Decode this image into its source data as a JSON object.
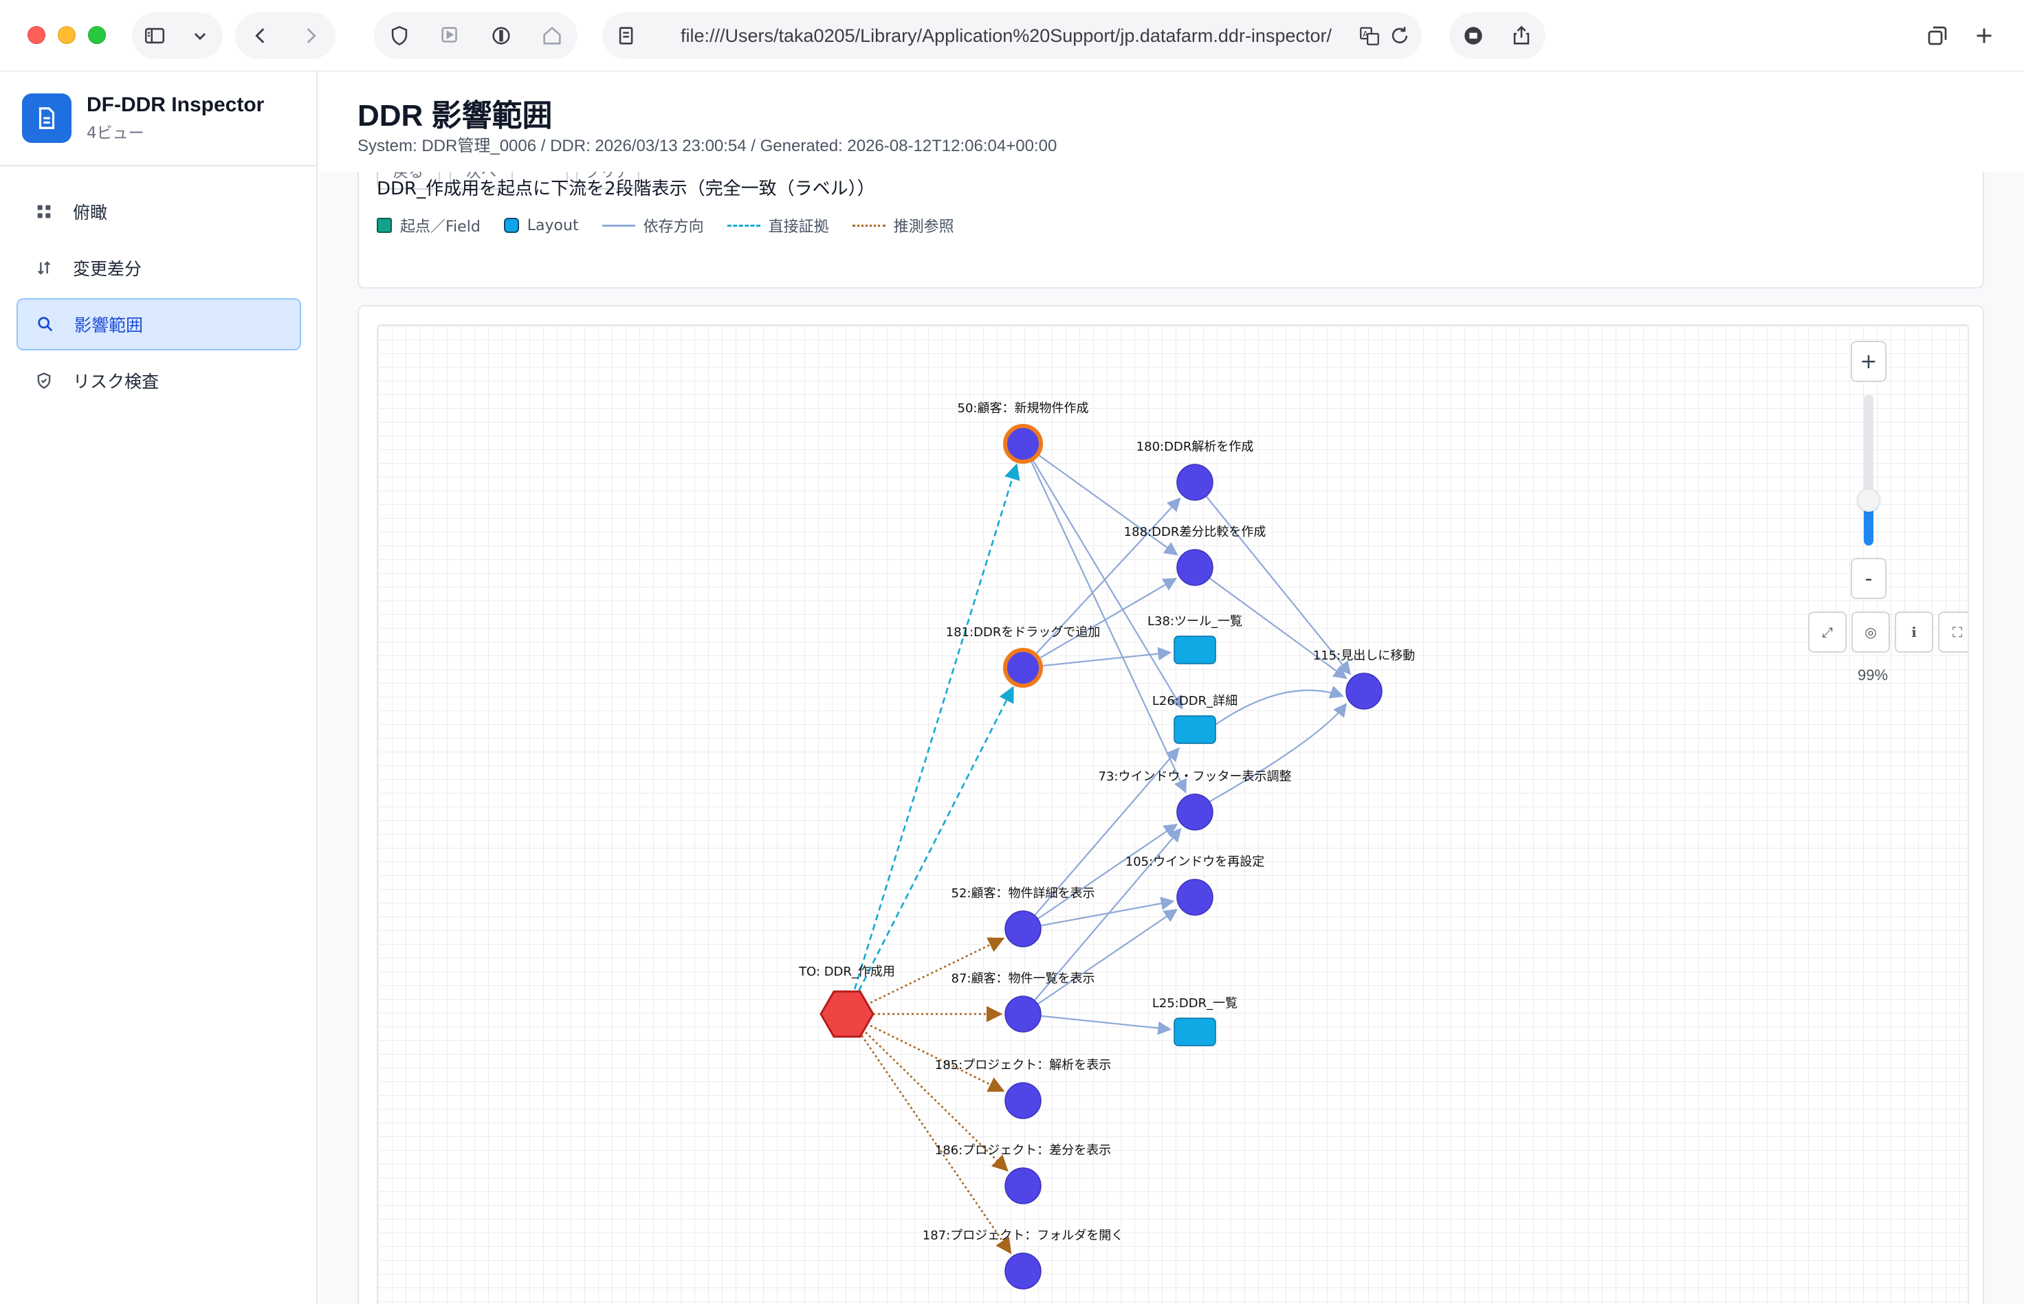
{
  "browser": {
    "url": "file:///Users/taka0205/Library/Application%20Support/jp.datafarm.ddr-inspector/"
  },
  "sidebar": {
    "brand_title": "DF-DDR Inspector",
    "brand_subtitle": "4ビュー",
    "items": [
      {
        "label": "俯瞰",
        "icon": "grid-icon",
        "active": false
      },
      {
        "label": "変更差分",
        "icon": "sort-arrows-icon",
        "active": false
      },
      {
        "label": "影響範囲",
        "icon": "search-icon",
        "active": true
      },
      {
        "label": "リスク検査",
        "icon": "shield-icon",
        "active": false
      }
    ]
  },
  "header": {
    "title": "DDR 影響範囲",
    "meta": "System: DDR管理_0006 / DDR: 2026/03/13 23:00:54 / Generated: 2026-08-12T12:06:04+00:00"
  },
  "filter": {
    "buttons": [
      "戻る",
      "次へ",
      "クリア"
    ],
    "description": "DDR_作成用を起点に下流を2段階表示（完全一致（ラベル））",
    "legend": [
      {
        "label": "起点／Field",
        "kind": "field"
      },
      {
        "label": "Layout",
        "kind": "layout"
      },
      {
        "label": "依存方向",
        "kind": "dep"
      },
      {
        "label": "直接証拠",
        "kind": "direct"
      },
      {
        "label": "推測参照",
        "kind": "infer"
      }
    ]
  },
  "graph": {
    "colors": {
      "node": "#5045e6",
      "layout": "#11a8e6",
      "highlight_ring": "#f07a1a",
      "origin": "#ee4444",
      "dep_edge": "#8ea8d8",
      "direct_edge": "#14a9d2",
      "infer_edge": "#a8651c"
    },
    "nodes": [
      {
        "id": "n50",
        "label": "50:顧客：新規物件作成",
        "type": "script",
        "highlight": true
      },
      {
        "id": "n180",
        "label": "180:DDR解析を作成",
        "type": "script"
      },
      {
        "id": "n188",
        "label": "188:DDR差分比較を作成",
        "type": "script"
      },
      {
        "id": "L38",
        "label": "L38:ツール_一覧",
        "type": "layout"
      },
      {
        "id": "n181",
        "label": "181:DDRをドラッグで追加",
        "type": "script",
        "highlight": true
      },
      {
        "id": "n115",
        "label": "115:見出しに移動",
        "type": "script"
      },
      {
        "id": "L26",
        "label": "L26:DDR_詳細",
        "type": "layout"
      },
      {
        "id": "n73",
        "label": "73:ウインドウ・フッター表示調整",
        "type": "script"
      },
      {
        "id": "n105",
        "label": "105:ウインドウを再設定",
        "type": "script"
      },
      {
        "id": "n52",
        "label": "52:顧客：物件詳細を表示",
        "type": "script"
      },
      {
        "id": "TO",
        "label": "TO: DDR_作成用",
        "type": "origin"
      },
      {
        "id": "n87",
        "label": "87:顧客：物件一覧を表示",
        "type": "script"
      },
      {
        "id": "L25",
        "label": "L25:DDR_一覧",
        "type": "layout"
      },
      {
        "id": "n185",
        "label": "185:プロジェクト：解析を表示",
        "type": "script"
      },
      {
        "id": "n186",
        "label": "186:プロジェクト：差分を表示",
        "type": "script"
      },
      {
        "id": "n187",
        "label": "187:プロジェクト：フォルダを開く",
        "type": "script"
      }
    ],
    "edges": [
      {
        "from": "TO",
        "to": "n50",
        "kind": "direct"
      },
      {
        "from": "TO",
        "to": "n181",
        "kind": "direct"
      },
      {
        "from": "TO",
        "to": "n52",
        "kind": "infer"
      },
      {
        "from": "TO",
        "to": "n87",
        "kind": "infer"
      },
      {
        "from": "TO",
        "to": "n185",
        "kind": "infer"
      },
      {
        "from": "TO",
        "to": "n186",
        "kind": "infer"
      },
      {
        "from": "TO",
        "to": "n187",
        "kind": "infer"
      },
      {
        "from": "n50",
        "to": "n188",
        "kind": "dep"
      },
      {
        "from": "n50",
        "to": "L26",
        "kind": "dep"
      },
      {
        "from": "n50",
        "to": "n73",
        "kind": "dep"
      },
      {
        "from": "n181",
        "to": "n180",
        "kind": "dep"
      },
      {
        "from": "n181",
        "to": "n188",
        "kind": "dep"
      },
      {
        "from": "n181",
        "to": "L38",
        "kind": "dep"
      },
      {
        "from": "n188",
        "to": "n115",
        "kind": "dep"
      },
      {
        "from": "n180",
        "to": "n115",
        "kind": "dep"
      },
      {
        "from": "L26",
        "to": "n115",
        "kind": "dep"
      },
      {
        "from": "n73",
        "to": "n115",
        "kind": "dep"
      },
      {
        "from": "n52",
        "to": "L26",
        "kind": "dep"
      },
      {
        "from": "n52",
        "to": "n73",
        "kind": "dep"
      },
      {
        "from": "n52",
        "to": "n105",
        "kind": "dep"
      },
      {
        "from": "n87",
        "to": "n73",
        "kind": "dep"
      },
      {
        "from": "n87",
        "to": "n105",
        "kind": "dep"
      },
      {
        "from": "n87",
        "to": "L25",
        "kind": "dep"
      }
    ],
    "zoom": {
      "percent_label": "99%",
      "level": 0.99,
      "plus": "+",
      "minus": "-",
      "tools": [
        {
          "icon": "fit-icon",
          "glyph": "⤢"
        },
        {
          "icon": "target-icon",
          "glyph": "◎"
        },
        {
          "icon": "info-icon",
          "glyph": "i"
        },
        {
          "icon": "fullscreen-icon",
          "glyph": "⛶"
        }
      ]
    }
  }
}
